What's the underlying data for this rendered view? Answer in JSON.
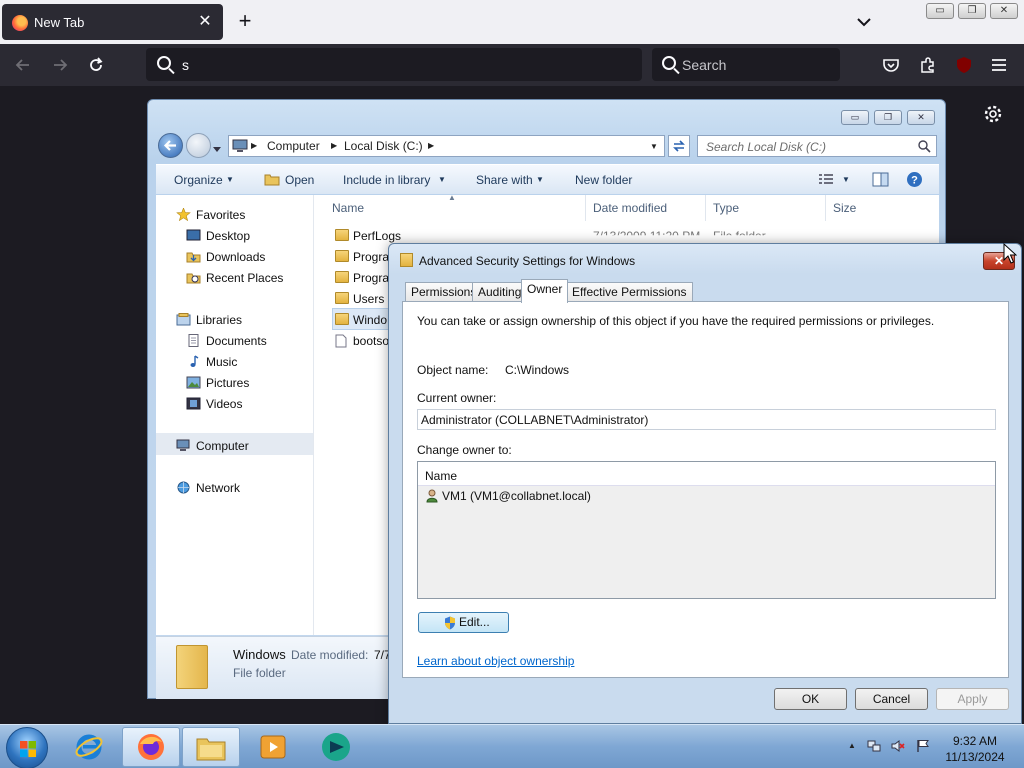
{
  "browser": {
    "tab_title": "New Tab",
    "tab_close": "✕",
    "new_tab": "+",
    "url_value": "s",
    "search_placeholder": "Search",
    "window_controls": [
      "▭",
      "❐",
      "✕"
    ]
  },
  "explorer": {
    "breadcrumb": [
      "Computer",
      "Local Disk (C:)"
    ],
    "search_placeholder": "Search Local Disk (C:)",
    "commands": {
      "organize": "Organize",
      "open": "Open",
      "include_in_library": "Include in library",
      "share_with": "Share with",
      "new_folder": "New folder"
    },
    "nav": {
      "favorites": "Favorites",
      "desktop": "Desktop",
      "downloads": "Downloads",
      "recent_places": "Recent Places",
      "libraries": "Libraries",
      "documents": "Documents",
      "music": "Music",
      "pictures": "Pictures",
      "videos": "Videos",
      "computer": "Computer",
      "network": "Network"
    },
    "columns": {
      "name": "Name",
      "date_modified": "Date modified",
      "type": "Type",
      "size": "Size"
    },
    "files": [
      {
        "name": "PerfLogs",
        "date": "7/13/2009 11:20 PM",
        "type": "File folder"
      },
      {
        "name": "Progra"
      },
      {
        "name": "Progra"
      },
      {
        "name": "Users"
      },
      {
        "name": "Windo"
      },
      {
        "name": "bootso"
      }
    ],
    "details": {
      "name": "Windows",
      "date_label": "Date modified:",
      "date_value": "7/7",
      "type": "File folder"
    }
  },
  "dialog": {
    "title": "Advanced Security Settings for Windows",
    "close": "✕",
    "tabs": [
      "Permissions",
      "Auditing",
      "Owner",
      "Effective Permissions"
    ],
    "intro": "You can take or assign ownership of this object if you have the required permissions or privileges.",
    "object_name_label": "Object name:",
    "object_name_value": "C:\\Windows",
    "current_owner_label": "Current owner:",
    "current_owner_value": "Administrator (COLLABNET\\Administrator)",
    "change_owner_label": "Change owner to:",
    "list_header": "Name",
    "list_items": [
      "VM1 (VM1@collabnet.local)"
    ],
    "edit_button": "Edit...",
    "learn_link": "Learn about object ownership",
    "ok": "OK",
    "cancel": "Cancel",
    "apply": "Apply"
  },
  "taskbar": {
    "time": "9:32 AM",
    "date": "11/13/2024",
    "tray_arrow": "▲"
  }
}
